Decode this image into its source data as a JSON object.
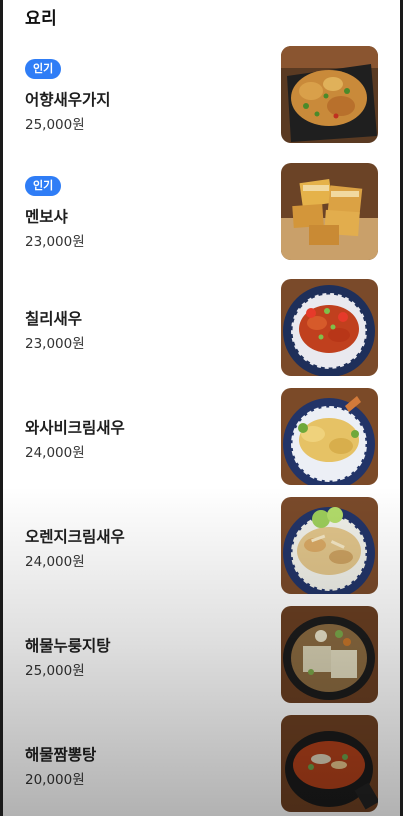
{
  "section": {
    "title": "요리"
  },
  "items": [
    {
      "name": "어향새우가지",
      "price": "25,000원",
      "badge": "인기",
      "image": "eggplant-shrimp-dish"
    },
    {
      "name": "멘보샤",
      "price": "23,000원",
      "badge": "인기",
      "image": "menbosha-dish"
    },
    {
      "name": "칠리새우",
      "price": "23,000원",
      "badge": "",
      "image": "chili-shrimp-dish"
    },
    {
      "name": "와사비크림새우",
      "price": "24,000원",
      "badge": "",
      "image": "wasabi-cream-shrimp-dish"
    },
    {
      "name": "오렌지크림새우",
      "price": "24,000원",
      "badge": "",
      "image": "orange-cream-shrimp-dish"
    },
    {
      "name": "해물누룽지탕",
      "price": "25,000원",
      "badge": "",
      "image": "seafood-nurungji-soup"
    },
    {
      "name": "해물짬뽕탕",
      "price": "20,000원",
      "badge": "",
      "image": "seafood-jjamppong-soup"
    }
  ],
  "colors": {
    "badge_bg": "#2f7df6",
    "text": "#1e1e1e",
    "frame": "#1a1a1a"
  }
}
